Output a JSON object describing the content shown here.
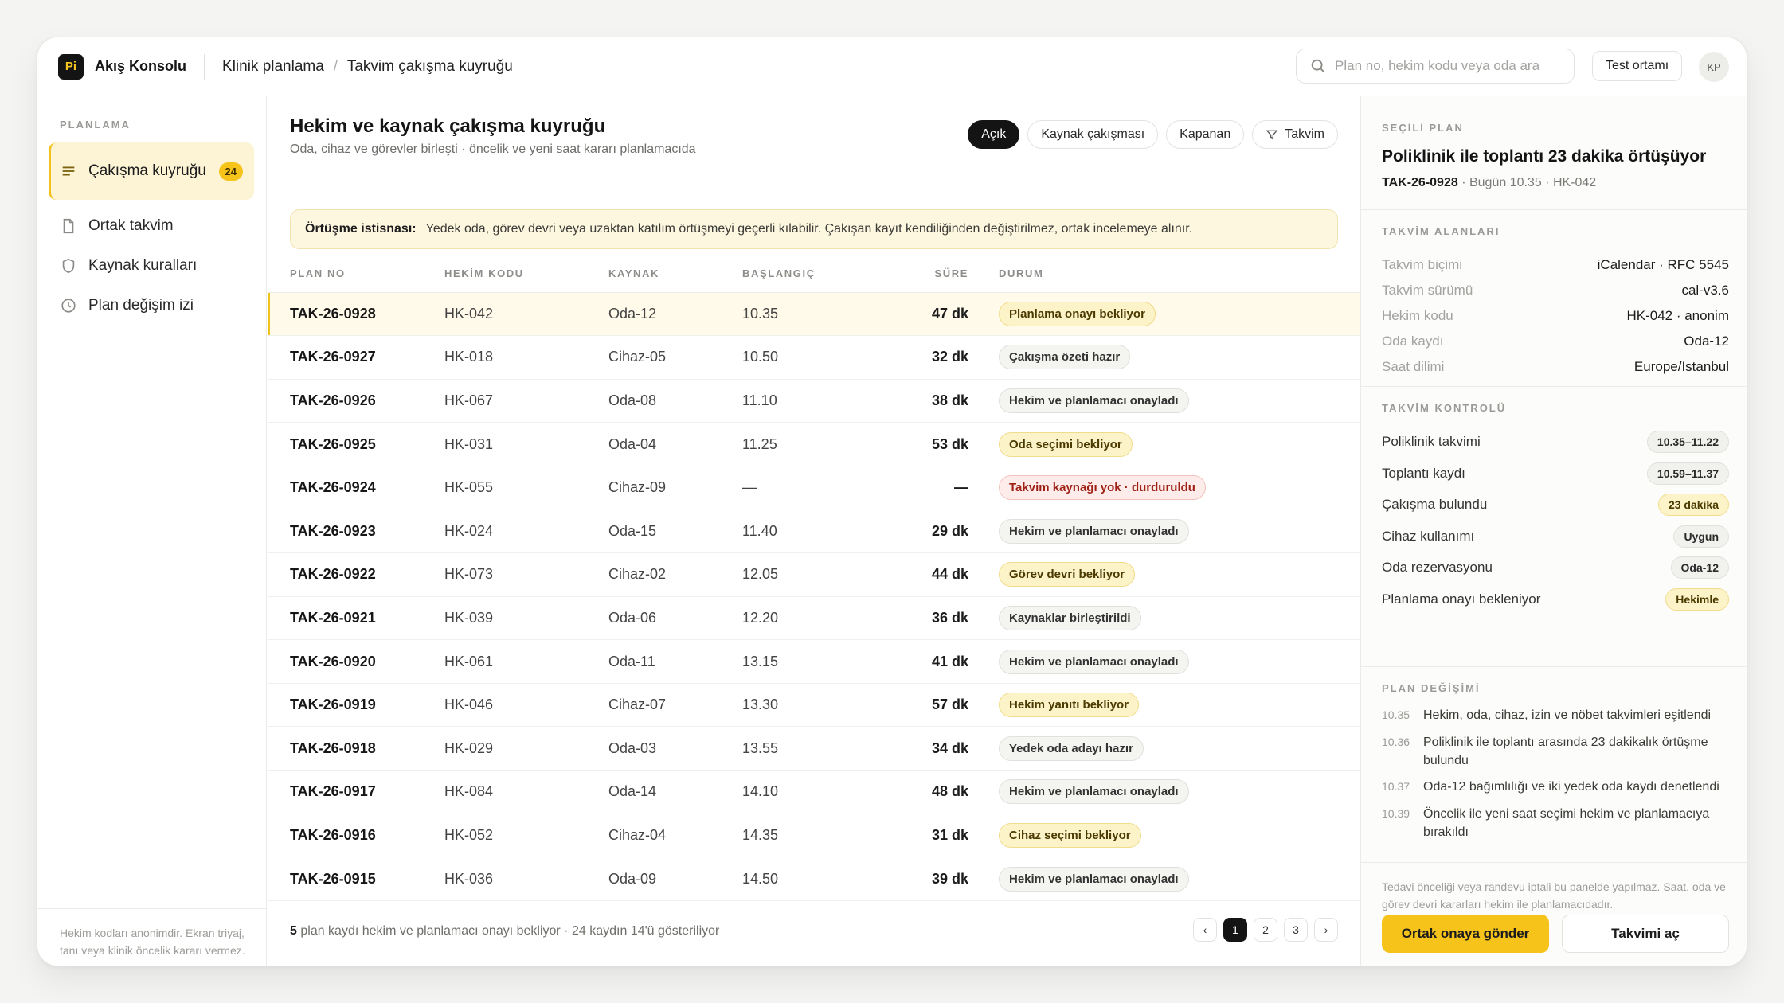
{
  "app": {
    "logo_text": "Pi",
    "title": "Akış Konsolu",
    "breadcrumb": [
      "Klinik planlama",
      "Takvim çakışma kuyruğu"
    ],
    "breadcrumb_sep": "/",
    "search_placeholder": "Plan no, hekim kodu veya oda ara",
    "env_label": "Test ortamı",
    "avatar_initials": "KP"
  },
  "sidebar": {
    "section_label": "PLANLAMA",
    "items": [
      {
        "label": "Çakışma kuyruğu",
        "icon": "list-icon",
        "badge": "24",
        "active": true
      },
      {
        "label": "Ortak takvim",
        "icon": "document-icon"
      },
      {
        "label": "Kaynak kuralları",
        "icon": "shield-icon"
      },
      {
        "label": "Plan değişim izi",
        "icon": "clock-icon"
      }
    ],
    "footer_note": "Hekim kodları anonimdir. Ekran triyaj, tanı veya klinik öncelik kararı vermez."
  },
  "main": {
    "title": "Hekim ve kaynak çakışma kuyruğu",
    "subtitle": "Oda, cihaz ve görevler birleşti · öncelik ve yeni saat kararı planlamacıda",
    "filters": [
      "Açık",
      "Kaynak çakışması",
      "Kapanan",
      "Takvim"
    ],
    "notice_title": "Örtüşme istisnası:",
    "notice_text": "Yedek oda, görev devri veya uzaktan katılım örtüşmeyi geçerli kılabilir. Çakışan kayıt kendiliğinden değiştirilmez, ortak incelemeye alınır.",
    "columns": [
      "PLAN NO",
      "HEKİM KODU",
      "KAYNAK",
      "BAŞLANGIÇ",
      "SÜRE",
      "DURUM"
    ],
    "rows": [
      {
        "plan": "TAK-26-0928",
        "hekim": "HK-042",
        "kaynak": "Oda-12",
        "baslangic": "10.35",
        "sure": "47 dk",
        "durum": "Planlama onayı bekliyor",
        "tone": "warn"
      },
      {
        "plan": "TAK-26-0927",
        "hekim": "HK-018",
        "kaynak": "Cihaz-05",
        "baslangic": "10.50",
        "sure": "32 dk",
        "durum": "Çakışma özeti hazır",
        "tone": "neutral"
      },
      {
        "plan": "TAK-26-0926",
        "hekim": "HK-067",
        "kaynak": "Oda-08",
        "baslangic": "11.10",
        "sure": "38 dk",
        "durum": "Hekim ve planlamacı onayladı",
        "tone": "neutral"
      },
      {
        "plan": "TAK-26-0925",
        "hekim": "HK-031",
        "kaynak": "Oda-04",
        "baslangic": "11.25",
        "sure": "53 dk",
        "durum": "Oda seçimi bekliyor",
        "tone": "warn"
      },
      {
        "plan": "TAK-26-0924",
        "hekim": "HK-055",
        "kaynak": "Cihaz-09",
        "baslangic": "—",
        "sure": "—",
        "durum": "Takvim kaynağı yok · durduruldu",
        "tone": "err"
      },
      {
        "plan": "TAK-26-0923",
        "hekim": "HK-024",
        "kaynak": "Oda-15",
        "baslangic": "11.40",
        "sure": "29 dk",
        "durum": "Hekim ve planlamacı onayladı",
        "tone": "neutral"
      },
      {
        "plan": "TAK-26-0922",
        "hekim": "HK-073",
        "kaynak": "Cihaz-02",
        "baslangic": "12.05",
        "sure": "44 dk",
        "durum": "Görev devri bekliyor",
        "tone": "warn"
      },
      {
        "plan": "TAK-26-0921",
        "hekim": "HK-039",
        "kaynak": "Oda-06",
        "baslangic": "12.20",
        "sure": "36 dk",
        "durum": "Kaynaklar birleştirildi",
        "tone": "neutral"
      },
      {
        "plan": "TAK-26-0920",
        "hekim": "HK-061",
        "kaynak": "Oda-11",
        "baslangic": "13.15",
        "sure": "41 dk",
        "durum": "Hekim ve planlamacı onayladı",
        "tone": "neutral"
      },
      {
        "plan": "TAK-26-0919",
        "hekim": "HK-046",
        "kaynak": "Cihaz-07",
        "baslangic": "13.30",
        "sure": "57 dk",
        "durum": "Hekim yanıtı bekliyor",
        "tone": "warn"
      },
      {
        "plan": "TAK-26-0918",
        "hekim": "HK-029",
        "kaynak": "Oda-03",
        "baslangic": "13.55",
        "sure": "34 dk",
        "durum": "Yedek oda adayı hazır",
        "tone": "neutral"
      },
      {
        "plan": "TAK-26-0917",
        "hekim": "HK-084",
        "kaynak": "Oda-14",
        "baslangic": "14.10",
        "sure": "48 dk",
        "durum": "Hekim ve planlamacı onayladı",
        "tone": "neutral"
      },
      {
        "plan": "TAK-26-0916",
        "hekim": "HK-052",
        "kaynak": "Cihaz-04",
        "baslangic": "14.35",
        "sure": "31 dk",
        "durum": "Cihaz seçimi bekliyor",
        "tone": "warn"
      },
      {
        "plan": "TAK-26-0915",
        "hekim": "HK-036",
        "kaynak": "Oda-09",
        "baslangic": "14.50",
        "sure": "39 dk",
        "durum": "Hekim ve planlamacı onayladı",
        "tone": "neutral"
      }
    ],
    "footer_count": "5",
    "footer_text": "plan kaydı hekim ve planlamacı onayı bekliyor · 24 kaydın 14'ü gösteriliyor",
    "pages": [
      "‹",
      "1",
      "2",
      "3",
      "›"
    ]
  },
  "detail": {
    "label": "SEÇİLİ PLAN",
    "title": "Poliklinik ile toplantı 23 dakika örtüşüyor",
    "plan_no": "TAK-26-0928",
    "meta": "·  Bugün 10.35 · HK-042",
    "fields_label": "TAKVİM ALANLARI",
    "fields": [
      {
        "k": "Takvim biçimi",
        "v": "iCalendar · RFC 5545"
      },
      {
        "k": "Takvim sürümü",
        "v": "cal-v3.6"
      },
      {
        "k": "Hekim kodu",
        "v": "HK-042 · anonim"
      },
      {
        "k": "Oda kaydı",
        "v": "Oda-12"
      },
      {
        "k": "Saat dilimi",
        "v": "Europe/Istanbul"
      }
    ],
    "checks_label": "TAKVİM KONTROLÜ",
    "checks": [
      {
        "k": "Poliklinik takvimi",
        "v": "10.35–11.22",
        "tone": "neutral"
      },
      {
        "k": "Toplantı kaydı",
        "v": "10.59–11.37",
        "tone": "neutral"
      },
      {
        "k": "Çakışma bulundu",
        "v": "23 dakika",
        "tone": "warn"
      },
      {
        "k": "Cihaz kullanımı",
        "v": "Uygun",
        "tone": "neutral"
      },
      {
        "k": "Oda rezervasyonu",
        "v": "Oda-12",
        "tone": "neutral"
      },
      {
        "k": "Planlama onayı bekleniyor",
        "v": "Hekimle",
        "tone": "warn"
      }
    ],
    "log_label": "PLAN DEĞİŞİMİ",
    "log": [
      {
        "t": "10.35",
        "text": "Hekim, oda, cihaz, izin ve nöbet takvimleri eşitlendi"
      },
      {
        "t": "10.36",
        "text": "Poliklinik ile toplantı arasında 23 dakikalık örtüşme bulundu"
      },
      {
        "t": "10.37",
        "text": "Oda-12 bağımlılığı ve iki yedek oda kaydı denetlendi"
      },
      {
        "t": "10.39",
        "text": "Öncelik ile yeni saat seçimi hekim ve planlamacıya bırakıldı"
      }
    ],
    "note": "Tedavi önceliği veya randevu iptali bu panelde yapılmaz. Saat, oda ve görev devri kararları hekim ile planlamacıdadır.",
    "primary_button": "Ortak onaya gönder",
    "secondary_button": "Takvimi aç"
  },
  "colors": {
    "accent": "#f6c31a",
    "dark": "#141414",
    "warn_bg": "#fdf3c8",
    "error_text": "#9e1f14"
  }
}
